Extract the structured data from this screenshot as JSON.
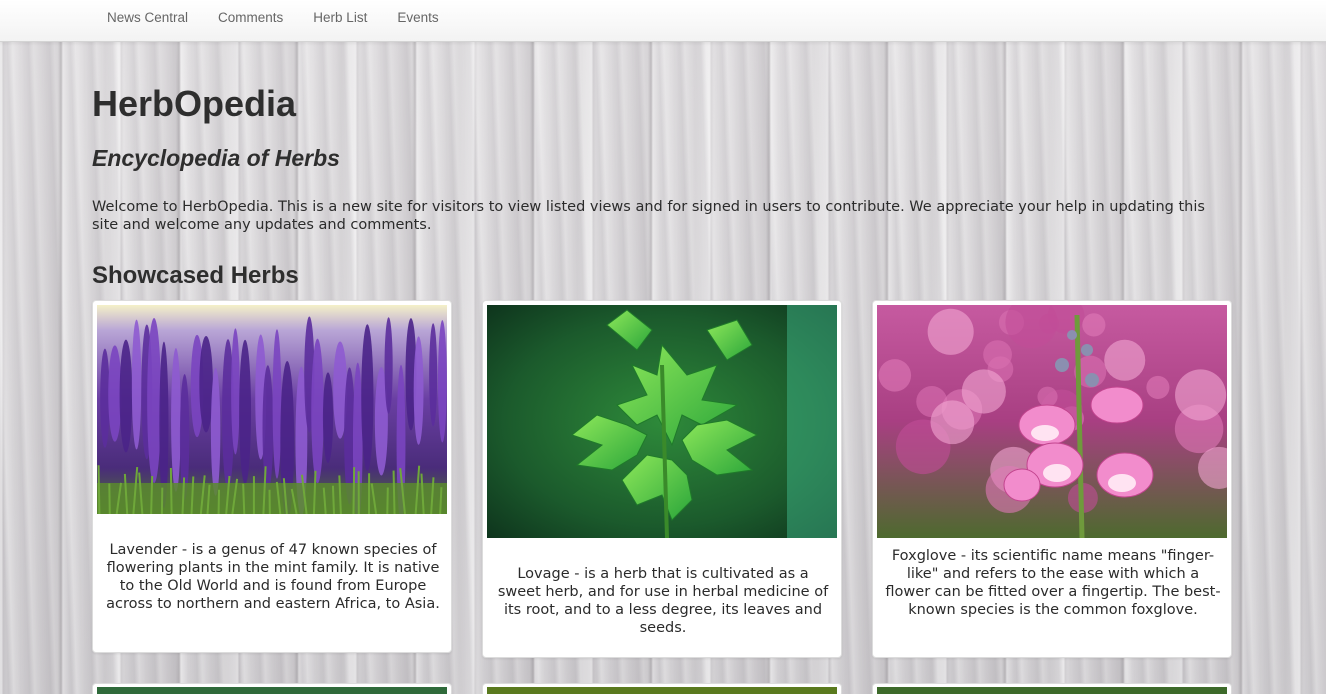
{
  "nav": {
    "items": [
      {
        "label": "News Central"
      },
      {
        "label": "Comments"
      },
      {
        "label": "Herb List"
      },
      {
        "label": "Events"
      }
    ]
  },
  "header": {
    "title": "HerbOpedia",
    "subtitle": "Encyclopedia of Herbs"
  },
  "intro": {
    "text": "Welcome to HerbOpedia. This is a new site for visitors to view listed views and for signed in users to contribute. We appreciate your help in updating this site and welcome any updates and comments."
  },
  "showcase": {
    "heading": "Showcased Herbs",
    "cards": [
      {
        "text": "Lavender - is a genus of 47 known species of flowering plants in the mint family. It is native to the Old World and is found from Europe across to northern and eastern Africa, to Asia.",
        "image_icon": "lavender-photo"
      },
      {
        "text": "Lovage - is a herb that is cultivated as a sweet herb, and for use in herbal medicine of its root, and to a less degree, its leaves and seeds.",
        "image_icon": "lovage-photo"
      },
      {
        "text": "Foxglove - its scientific name means \"finger-like\" and refers to the ease with which a flower can be fitted over a fingertip. The best-known species is the common foxglove.",
        "image_icon": "foxglove-photo"
      }
    ]
  },
  "colors": {
    "nav_text": "#666666",
    "heading_text": "#2e2e2e",
    "card_background": "#ffffff"
  }
}
